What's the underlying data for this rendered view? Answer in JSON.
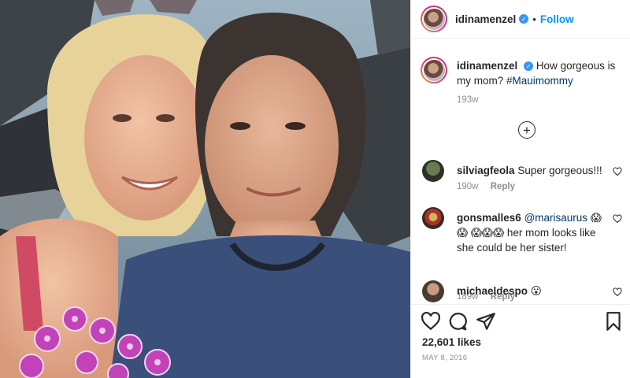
{
  "post": {
    "username": "idinamenzel",
    "follow_label": "Follow",
    "separator": "•",
    "caption_username": "idinamenzel",
    "caption_text": "How gorgeous is my mom?",
    "caption_tag": "#Mauimommy",
    "caption_time": "193w",
    "likes": "22,601 likes",
    "date": "MAY 8, 2016"
  },
  "comments": [
    {
      "username": "silviagfeola",
      "text": "Super gorgeous!!!",
      "time": "190w",
      "reply": "Reply"
    },
    {
      "username": "gonsmalles6",
      "mention": "@marisaurus",
      "text": "her mom looks like she could be her sister!",
      "time": "189w",
      "reply": "Reply",
      "emoji": "😱"
    },
    {
      "username": "michaeldespo",
      "text": "",
      "emoji": "😮"
    }
  ],
  "icons": {
    "verified": "verified-badge-icon",
    "load_more": "plus-circle-icon",
    "like": "heart-icon",
    "comment": "comment-icon",
    "share": "paper-plane-icon",
    "save": "bookmark-icon"
  },
  "colors": {
    "accent": "#0095f6",
    "tag": "#00376b",
    "muted": "#8e8e8e",
    "text": "#262626",
    "border": "#efefef"
  }
}
